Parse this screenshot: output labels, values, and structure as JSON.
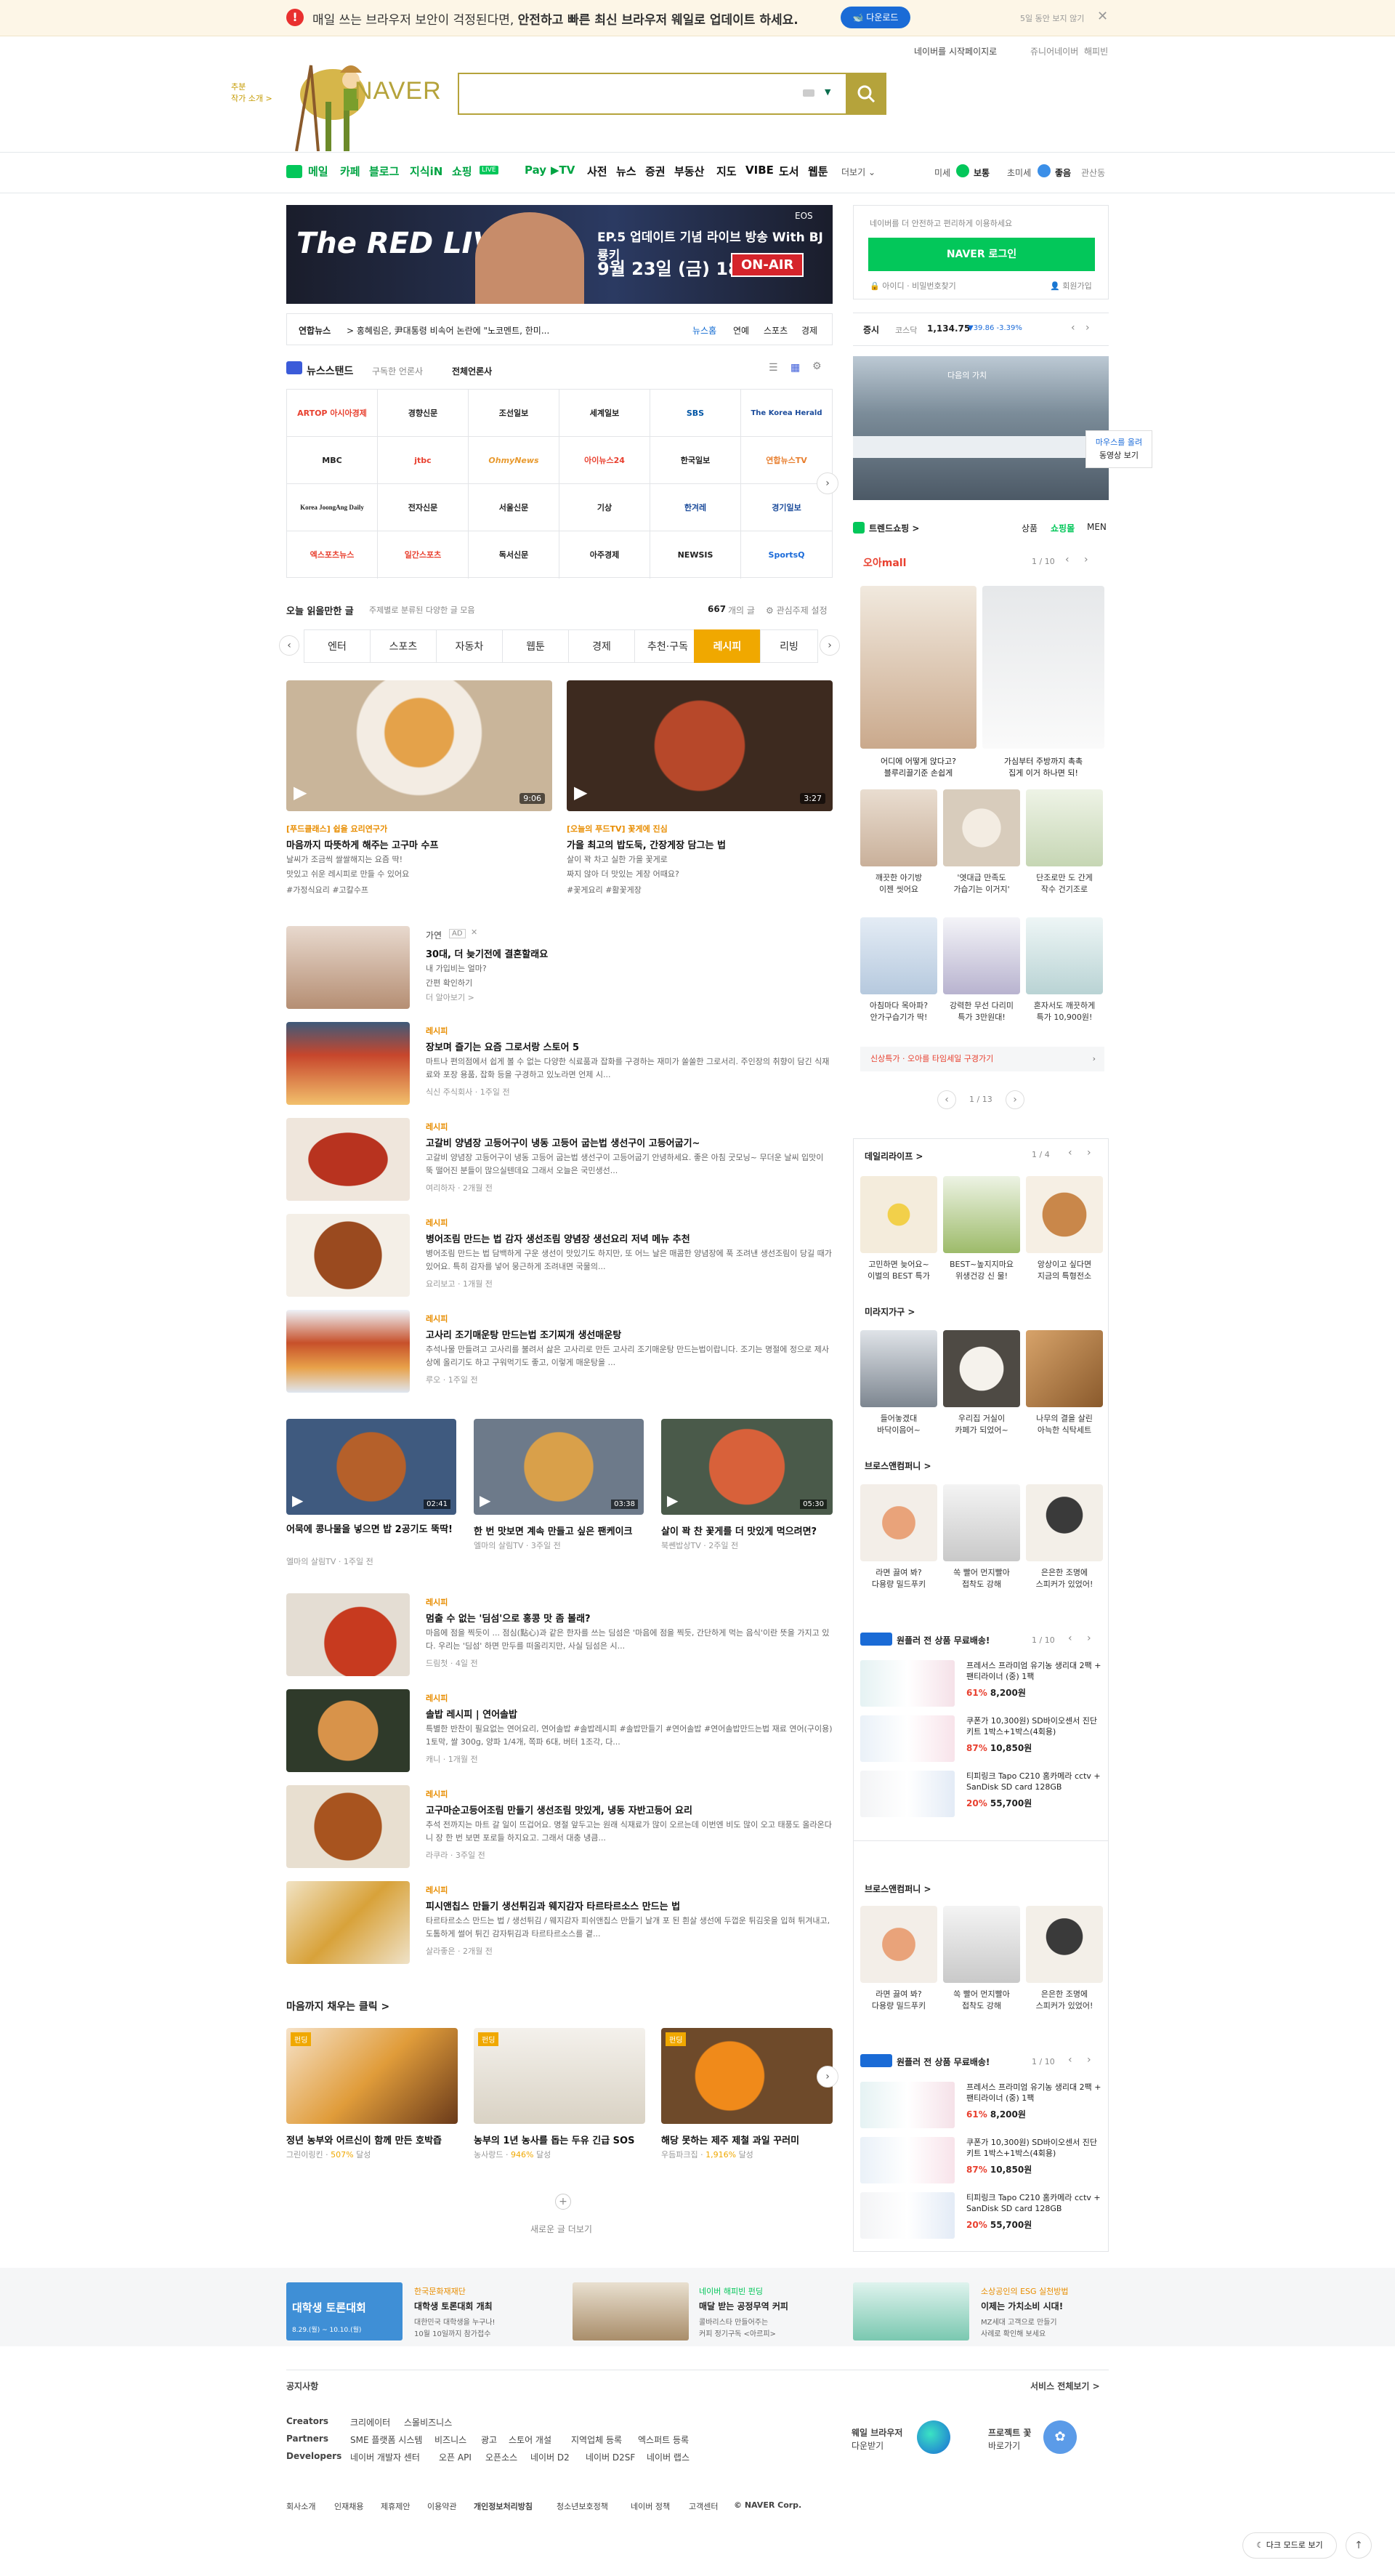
{
  "banner": {
    "message_pre": "매일 쓰는 브라우저 보안이 걱정된다면, ",
    "message_bold": "안전하고 빠른 최신 브라우저 웨일로 업데이트 하세요.",
    "download_label": "다운로드",
    "later_label": "5일 동안 보지 않기"
  },
  "header": {
    "links": [
      "네이버를 시작페이지로",
      "쥬니어네이버",
      "해피빈"
    ],
    "logo_text": "NAVER",
    "doodle_caption": "추분\n작가 소개 >"
  },
  "nav": {
    "items": [
      "메일",
      "카페",
      "블로그",
      "지식iN",
      "쇼핑",
      "LIVE",
      "Pay",
      "▶TV",
      "사전",
      "뉴스",
      "증권",
      "부동산",
      "지도",
      "VIBE",
      "도서",
      "웹툰"
    ],
    "more": "더보기",
    "weather": {
      "fine_dust_label": "미세",
      "fine_dust_value": "보통",
      "ultra_label": "초미세",
      "ultra_value": "좋음",
      "location": "관산동"
    }
  },
  "ad": {
    "brand": "The RED LIVE",
    "line1": "EP.5 업데이트 기념 라이브 방송 With BJ룡키",
    "line2": "9월 23일 (금) 18시",
    "onair": "ON-AIR",
    "game": "EOS"
  },
  "news_ticker": {
    "source": "연합뉴스",
    "headline": "> 홍혜림은, 尹대통령 비속어 논란에 \"노코멘트, 한미...",
    "links": [
      "뉴스홈",
      "연예",
      "스포츠",
      "경제"
    ]
  },
  "newsstand": {
    "title": "뉴스스탠드",
    "sub1": "구독한 언론사",
    "sub2": "전체언론사",
    "press": [
      "ARTOP 아시아경제",
      "경향신문",
      "조선일보",
      "세계일보",
      "SBS",
      "The Korea Herald",
      "MBC",
      "jtbc",
      "OhmyNews",
      "아이뉴스24",
      "한국일보",
      "연합뉴스TV",
      "Korea JoongAng Daily",
      "전자신문",
      "서울신문",
      "기상",
      "한겨레",
      "경기일보",
      "엑스포츠뉴스",
      "일간스포츠",
      "독서신문",
      "아주경제",
      "NEWSIS",
      "SportsQ"
    ]
  },
  "feed": {
    "title": "오늘 읽을만한 글",
    "sub": "주제별로 분류된 다양한 글 모음",
    "count": "667",
    "count_suffix": "개의 글",
    "settings": "관심주제 설정",
    "tabs": [
      "엔터",
      "스포츠",
      "자동차",
      "웹툰",
      "경제",
      "추천·구독",
      "레시피",
      "리빙"
    ],
    "video1": {
      "dur": "9:06",
      "channel": "[푸드클래스] 쉽을 요리연구가",
      "title": "마음까지 따뜻하게 해주는 고구마 수프",
      "desc1": "날씨가 조금씩 쌀쌀해지는 요즘 딱!",
      "desc2": "맛있고 쉬운 레시피로 만들 수 있어요",
      "tags": "#가정식요리 #고칼수프"
    },
    "video2": {
      "dur": "3:27",
      "channel": "[오늘의 푸드TV] 꽃게에 진심",
      "title": "가을 최고의 밥도둑, 간장게장 담그는 법",
      "desc1": "살이 꽉 차고 실한 가을 꽃게로",
      "desc2": "짜지 않아 더 맛있는 게장 어때요?",
      "tags": "#꽃게요리 #활꽃게장"
    },
    "adrow": {
      "label": "가연",
      "ad": "AD",
      "title": "30대, 더 늦기전에 결혼할래요",
      "d1": "내 가입비는 얼마?",
      "d2": "간편 확인하기",
      "more": "더 알아보기 >"
    },
    "articles": [
      {
        "cat": "레시피",
        "title": "장보며 즐기는 요즘 그로서랑 스토어 5",
        "desc": "마트나 편의점에서 쉽게 볼 수 없는 다양한 식료품과 잡화를 구경하는 재미가 쏠쏠한 그로서리. 주인장의 취향이 담긴 식재료와 포장 용품, 잡화 등을 구경하고 있노라면 언제 시...",
        "meta": "식신 주식회사 · 1주일 전"
      },
      {
        "cat": "레시피",
        "title": "고갈비 양념장 고등어구이 냉동 고등어 굽는법 생선구이 고등어굽기~",
        "desc": "고갈비 양념장 고등어구이 냉동 고등어 굽는법 생선구이 고등어굽기 안녕하세요. 좋은 아침 굿모닝~ 무더운 날씨 입맛이 뚝 떨어진 분들이 많으실텐데요 그래서 오늘은 국민생선...",
        "meta": "여리하자 · 2개월 전"
      },
      {
        "cat": "레시피",
        "title": "병어조림 만드는 법 감자 생선조림 양념장 생선요리 저녁 메뉴 추천",
        "desc": "병어조림 만드는 법 담백하게 구운 생선이 맛있기도 하지만, 또 어느 날은 매콤한 양념장에 푹 조려낸 생선조림이 당길 때가 있어요. 특히 감자를 넣어 뭉근하게 조려내면 국물의...",
        "meta": "요리보고 · 1개월 전"
      },
      {
        "cat": "레시피",
        "title": "고사리 조기매운탕 만드는법 조기찌개 생선매운탕",
        "desc": "추석나물 만들려고 고사리를 불려서 삶은 고사리로 만든 고사리 조기매운탕 만드는법이랍니다. 조기는 명절에 정으로 제사상에 올리기도 하고 구워먹기도 좋고, 이렇게 매운탕을 ...",
        "meta": "루오 · 1주일 전"
      }
    ],
    "videos": [
      {
        "dur": "02:41",
        "title": "어묵에 콩나물을 넣으면 밥 2공기도 뚝딱!",
        "meta": "엘마의 살림TV · 1주일 전"
      },
      {
        "dur": "03:38",
        "title": "한 번 맛보면 계속 만들고 싶은 팬케이크",
        "meta": "엘마의 살림TV · 3주일 전"
      },
      {
        "dur": "05:30",
        "title": "살이 꽉 찬 꽃게를 더 맛있게 먹으려면?",
        "meta": "북쏀밥상TV · 2주일 전"
      }
    ],
    "articles2": [
      {
        "cat": "레시피",
        "title": "멈출 수 없는 '딤섬'으로 홍콩 맛 좀 볼래?",
        "desc": "마음에 점을 찍듯이 ... 점심(點心)과 같은 한자를 쓰는 딤섬은 '마음에 점을 찍듯, 간단하게 먹는 음식'이란 뜻을 가지고 있다. 우리는 '딤섬' 하면 만두를 떠올리지만, 사실 딤섬은 시...",
        "meta": "드림첫 · 4일 전"
      },
      {
        "cat": "레시피",
        "title": "솔밥 레시피 | 연어솔밥",
        "desc": "특별한 반찬이 필요없는 연어요리, 연어솔밥 #솔밥레시피 #솔밥만들기 #연어솔밥 #연어솔밥만드는법 재료 연어(구이용) 1토막, 쌀 300g, 양파 1/4개, 쪽파 6대, 버터 1조각, 다...",
        "meta": "캐니 · 1개월 전"
      },
      {
        "cat": "레시피",
        "title": "고구마순고등어조림 만들기 생선조림 맛있게, 냉동 자반고등어 요리",
        "desc": "추석 전까지는 마트 갈 일이 뜨겁어요. 명절 앞두고는 원래 식재료가 많이 오르는데 이번엔 비도 많이 오고 태풍도 올라온다니 장 한 번 보면 포로들 하지요고. 그래서 대충 냉큼...",
        "meta": "라쿠라 · 3주일 전"
      },
      {
        "cat": "레시피",
        "title": "피시앤칩스 만들기 생선튀김과 웨지감자 타르타르소스 만드는 법",
        "desc": "타르타르소스 만드는 법 / 생선튀김 / 웨지감자 피쉬앤칩스 만들기 날개 포 된 흰살 생선에 두껍운 튀김옷을 입혀 튀겨내고, 도톰하게 썰어 튀긴 감자튀김과 타르타르소스를 곁...",
        "meta": "살라좋은 · 2개월 전"
      }
    ],
    "fund": {
      "title": "마음까지 채우는 클릭 >",
      "badge": "펀딩",
      "items": [
        {
          "title": "정년 농부와 어르신이 함께 만든 호박즙",
          "org": "그린이링킨",
          "pct": "507%",
          "suffix": "달성"
        },
        {
          "title": "농부의 1년 농사를 돕는 두유 긴급 SOS",
          "org": "농사랑드",
          "pct": "946%",
          "suffix": "달성"
        },
        {
          "title": "해당 못하는 제주 제철 과일 꾸러미",
          "org": "우듬파크집",
          "pct": "1,916%",
          "suffix": "달성"
        }
      ]
    },
    "more": "새로운 글 더보기"
  },
  "login": {
    "notice": "네이버를 더 안전하고 편리하게 이용하세요",
    "button": "NAVER 로그인",
    "find_id": "아이디",
    "find_pw": "비밀번호찾기",
    "join": "회원가입"
  },
  "stock": {
    "label": "증시",
    "index": "코스닥",
    "value": "1,134.75",
    "change": "▼39.86 -3.39%"
  },
  "banner_ad": {
    "caption": "다음의 가치",
    "side1": "마우스를 올려",
    "side2": "동영상 보기"
  },
  "shopping": {
    "title": "트렌드쇼핑 >",
    "tabs": [
      "상품",
      "쇼핑몰",
      "MEN"
    ],
    "mall": "오아mall",
    "page": "1 / 10",
    "items": [
      {
        "t1": "어디에 어떻게 앉다고?",
        "t2": "블루리끌기준 손쉽게"
      },
      {
        "t1": "가심부터 주방까지 촉촉",
        "t2": "집게 이거 하나면 되!"
      },
      {
        "t1": "깨끗한 아기방",
        "t2": "이젠 씻어요"
      },
      {
        "t1": "'엿대급 만족도",
        "t2": "가습기는 이거지'"
      },
      {
        "t1": "단조로만 도 간게",
        "t2": "작수 건기조로"
      },
      {
        "t1": "아침마다 목아파?",
        "t2": "안가구습기가 딱!"
      },
      {
        "t1": "강력한 무선 다리미",
        "t2": "특가 3만원대!"
      },
      {
        "t1": "혼자서도 깨끗하게",
        "t2": "특가 10,900원!"
      }
    ],
    "promo": "신상특가 · 오아를 타임세일 구경가기",
    "pager": "1 / 13"
  },
  "daily": {
    "title": "데일리라이프 >",
    "page": "1 / 4",
    "items": [
      {
        "t1": "고민하면 늦어요~",
        "t2": "이벌의 BEST 특가"
      },
      {
        "t1": "BEST~높지지마요",
        "t2": "위생건강 신 물!"
      },
      {
        "t1": "앙상이고 싶다면",
        "t2": "지금의 특형전소"
      }
    ]
  },
  "mirae": {
    "title": "미라지가구 >",
    "items": [
      {
        "t1": "들어놓겠대",
        "t2": "바닥이음어~"
      },
      {
        "t1": "우리집 거실이",
        "t2": "카페가 되었어~"
      },
      {
        "t1": "나무의 결을 살린",
        "t2": "아늑한 식탁세트"
      }
    ]
  },
  "bross": {
    "title": "브로스앤컴퍼니 >",
    "items": [
      {
        "t1": "라면 끓여 봐?",
        "t2": "다용량 밀드푸키"
      },
      {
        "t1": "쏙 빨어 먼지빨아",
        "t2": "접착도 강해"
      },
      {
        "t1": "은은한 조명에",
        "t2": "스피커가 있었어!"
      }
    ]
  },
  "deal": {
    "title": "원플러 전 상품 무료배송!",
    "page": "1 / 10",
    "items": [
      {
        "name": "프레서스 프라미엄 유기농 생리대 2팩 + 팬티라이너 (중) 1팩",
        "pct": "61%",
        "price": "8,200원"
      },
      {
        "name": "쿠폰가 10,300원) SD바이오센서 진단키트 1박스+1박스(4회용)",
        "pct": "87%",
        "price": "10,850원"
      },
      {
        "name": "티피링크 Tapo C210 홈카메라 cctv + SanDisk SD card 128GB",
        "pct": "20%",
        "price": "55,700원"
      }
    ]
  },
  "bottom_banners": [
    {
      "org": "한국문화재재단",
      "title": "대학생 토론대회 개최",
      "d1": "대한민국 대학생을 누구나!",
      "d2": "10월 10일까지 참가접수",
      "img": "대학생 토론대회",
      "date": "8.29.(월) ~ 10.10.(월)"
    },
    {
      "org": "네이버 해피빈 펀딩",
      "title": "매달 받는 공정무역 커피",
      "d1": "콜바리스타 만들어주는",
      "d2": "커피 정기구독 <아르피>"
    },
    {
      "org": "소상공인의 ESG 실천방법",
      "title": "이제는 가치소비 시대!",
      "d1": "MZ세대 고객으로 만들기",
      "d2": "사례로 확인해 보세요"
    }
  ],
  "footer": {
    "notice": "공지사항",
    "services": "서비스 전체보기 >",
    "creators_label": "Creators",
    "creators": [
      "크리에이터",
      "스몰비즈니스"
    ],
    "partners_label": "Partners",
    "partners": [
      "SME 플랫폼 시스템",
      "비즈니스",
      "광고",
      "스토어 개설",
      "지역업체 등록",
      "엑스퍼트 등록"
    ],
    "developers_label": "Developers",
    "developers": [
      "네이버 개발자 센터",
      "오픈 API",
      "오픈소스",
      "네이버 D2",
      "네이버 D2SF",
      "네이버 랩스"
    ],
    "whale_title": "웨일 브라우저",
    "whale_sub": "다운받기",
    "happy_title": "프로젝트 꽃",
    "happy_sub": "바로가기",
    "bottom": [
      "회사소개",
      "인재채용",
      "제휴제안",
      "이용약관",
      "개인정보처리방침",
      "청소년보호정책",
      "네이버 정책",
      "고객센터"
    ],
    "copy": "© NAVER Corp.",
    "dark": "다크 모드로 보기"
  },
  "colors": {
    "naver_green": "#03c75a",
    "accent_gold": "#b5a33b",
    "orange": "#f0a800",
    "price_red": "#e8402f"
  }
}
